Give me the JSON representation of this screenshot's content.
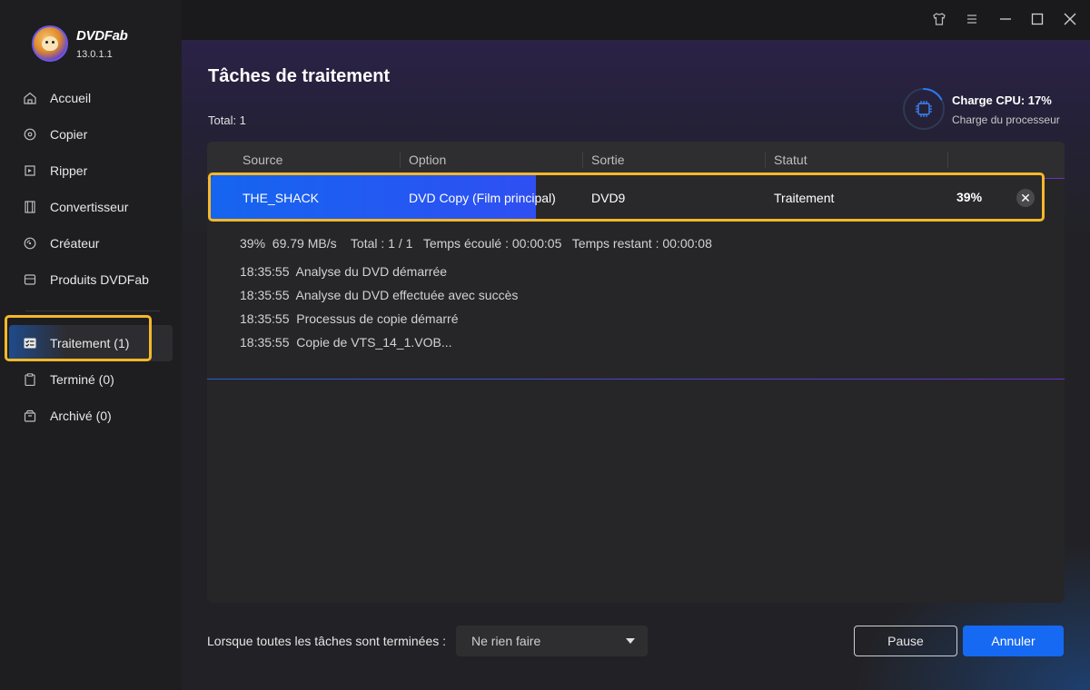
{
  "app": {
    "brand": "DVDFab",
    "version": "13.0.1.1"
  },
  "sidebar": {
    "items": [
      {
        "label": "Accueil",
        "icon": "home-icon"
      },
      {
        "label": "Copier",
        "icon": "copy-icon"
      },
      {
        "label": "Ripper",
        "icon": "ripper-icon"
      },
      {
        "label": "Convertisseur",
        "icon": "film-icon"
      },
      {
        "label": "Créateur",
        "icon": "disc-icon"
      },
      {
        "label": "Produits DVDFab",
        "icon": "box-icon"
      }
    ],
    "queue_items": [
      {
        "label": "Traitement (1)",
        "icon": "task-list-icon",
        "active": true
      },
      {
        "label": "Terminé (0)",
        "icon": "clipboard-icon"
      },
      {
        "label": "Archivé (0)",
        "icon": "archive-icon"
      }
    ]
  },
  "titlebar": {
    "icons": [
      "shirt-icon",
      "menu-icon",
      "minimize-icon",
      "maximize-icon",
      "close-icon"
    ]
  },
  "main": {
    "title": "Tâches de traitement",
    "total": "Total: 1",
    "cpu": {
      "label": "Charge CPU: 17%",
      "sub": "Charge du processeur",
      "percent": 17
    },
    "table": {
      "headers": [
        "Source",
        "Option",
        "Sortie",
        "Statut"
      ],
      "task": {
        "source": "THE_SHACK",
        "option": "DVD Copy (Film principal)",
        "output": "DVD9",
        "status": "Traitement",
        "percent_label": "39%",
        "progress": 0.39
      },
      "stats": "39%  69.79 MB/s    Total : 1 / 1   Temps écoulé : 00:00:05   Temps restant : 00:00:08",
      "log": [
        "18:35:55  Analyse du DVD démarrée",
        "18:35:55  Analyse du DVD effectuée avec succès",
        "18:35:55  Processus de copie démarré",
        "18:35:55  Copie de VTS_14_1.VOB..."
      ]
    },
    "footer": {
      "label": "Lorsque toutes les tâches sont terminées :",
      "select_value": "Ne rien faire",
      "pause": "Pause",
      "cancel": "Annuler"
    }
  },
  "colors": {
    "accent": "#1669f2",
    "highlight": "#f5b82a",
    "progress": "#1565f0"
  }
}
